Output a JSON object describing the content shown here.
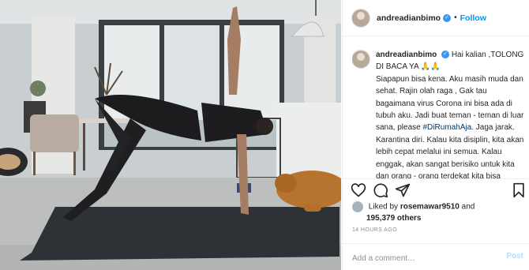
{
  "post": {
    "username": "andreadianbimo",
    "follow_label": "Follow",
    "separator": "•",
    "caption_first": "Hai kalian ,TOLONG DI BACA YA 🙏🙏",
    "caption_body": "Siapapun bisa kena. Aku masih muda dan sehat. Rajin olah raga , Gak tau bagaimana virus Corona ini bisa ada di tubuh aku. Jadi buat teman - teman di luar sana, please",
    "hashtag": "#DiRumahAja",
    "caption_rest": ". Jaga jarak. Karantina diri. Kalau kita disiplin, kita akan lebih cepat melalui ini semua. Kalau enggak, akan sangat berisiko untuk kita dan orang - orang terdekat kita bisa terinfeksi. Aku",
    "liked_by_prefix": "Liked by",
    "liked_by_user": "rosemawar9510",
    "liked_by_and": "and",
    "other_likes": "195,379 others",
    "timestamp": "14 HOURS AGO",
    "comment_placeholder": "Add a comment…",
    "post_button": "Post"
  },
  "icons": [
    "verified-badge",
    "heart-icon",
    "comment-icon",
    "share-icon",
    "bookmark-icon"
  ],
  "colors": {
    "accent": "#0095f6",
    "verified": "#3897f0",
    "muted": "#8e8e8e",
    "mat": "#2e3135"
  }
}
